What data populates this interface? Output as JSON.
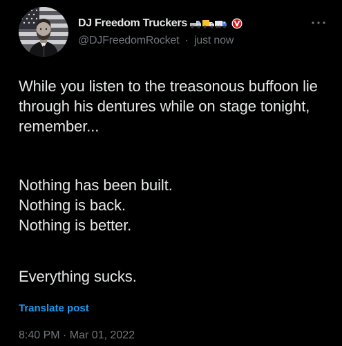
{
  "post": {
    "author": {
      "display_name": "DJ Freedom Truckers",
      "name_emojis": [
        "pickup-truck-emoji",
        "delivery-truck-emoji",
        "articulated-lorry-emoji"
      ],
      "verified_icon": "red-circle-v-badge-icon",
      "handle": "@DJFreedomRocket",
      "separator": "·",
      "relative_time": "just now"
    },
    "more_icon": "more-dots-icon",
    "paragraphs": [
      "While you listen to the treasonous buffoon lie through his dentures while on stage tonight, remember...",
      "Nothing has been built.\nNothing is back.\nNothing is better.",
      "Everything sucks."
    ],
    "translate_label": "Translate post",
    "timestamp": "8:40 PM · Mar 01, 2022",
    "colors": {
      "background": "#000000",
      "text": "#e7e9ea",
      "muted": "#71767b",
      "link": "#1d9bf0",
      "badge": "#d5141d"
    }
  }
}
